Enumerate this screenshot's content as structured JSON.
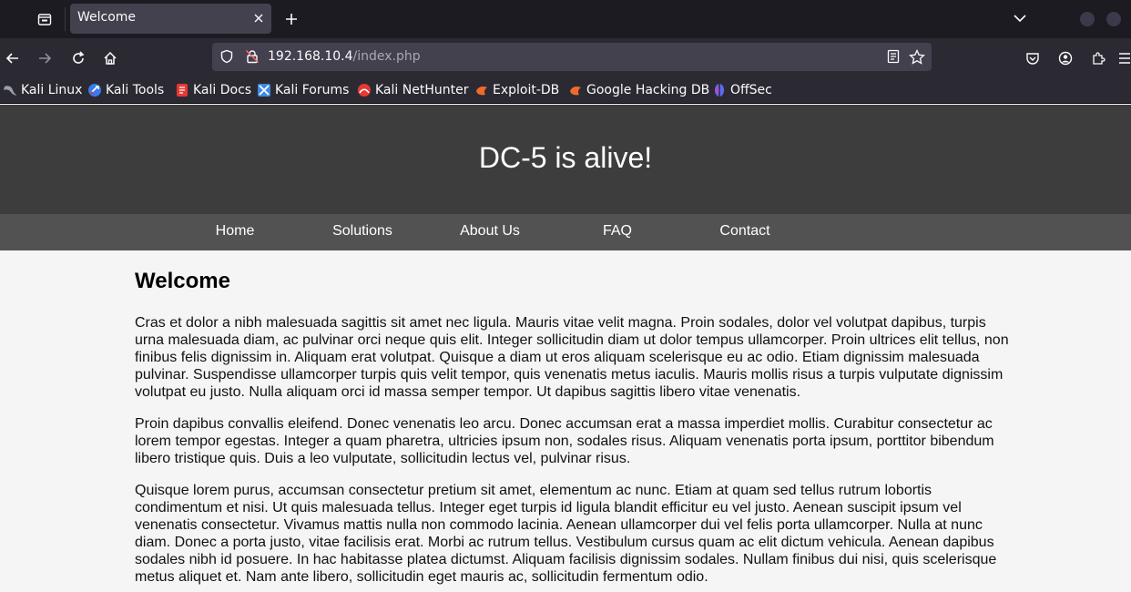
{
  "browser": {
    "tab_title": "Welcome",
    "url_host": "192.168.10.4",
    "url_path": "/index.php",
    "bookmarks": [
      {
        "label": "Kali Linux",
        "icon": "kali-dragon-icon",
        "color": "#9aa0a6"
      },
      {
        "label": "Kali Tools",
        "icon": "kali-tools-icon",
        "color": "#367bf0"
      },
      {
        "label": "Kali Docs",
        "icon": "kali-docs-icon",
        "color": "#e53935"
      },
      {
        "label": "Kali Forums",
        "icon": "kali-forums-icon",
        "color": "#3f8ae0"
      },
      {
        "label": "Kali NetHunter",
        "icon": "kali-nethunter-icon",
        "color": "#e53935"
      },
      {
        "label": "Exploit-DB",
        "icon": "exploit-db-icon",
        "color": "#f06a2b"
      },
      {
        "label": "Google Hacking DB",
        "icon": "ghdb-icon",
        "color": "#f06a2b"
      },
      {
        "label": "OffSec",
        "icon": "offsec-icon",
        "color": "#5b6cf0"
      }
    ]
  },
  "site": {
    "title": "DC-5 is alive!",
    "nav": [
      "Home",
      "Solutions",
      "About Us",
      "FAQ",
      "Contact"
    ],
    "heading": "Welcome",
    "paragraphs": [
      "Cras et dolor a nibh malesuada sagittis sit amet nec ligula. Mauris vitae velit magna. Proin sodales, dolor vel volutpat dapibus, turpis urna malesuada diam, ac pulvinar orci neque quis elit. Integer sollicitudin diam ut dolor tempus ullamcorper. Proin ultrices elit tellus, non finibus felis dignissim in. Aliquam erat volutpat. Quisque a diam ut eros aliquam scelerisque eu ac odio. Etiam dignissim malesuada pulvinar. Suspendisse ullamcorper turpis quis velit tempor, quis venenatis metus iaculis. Mauris mollis risus a turpis vulputate dignissim volutpat eu justo. Nulla aliquam orci id massa semper tempor. Ut dapibus sagittis libero vitae venenatis.",
      "Proin dapibus convallis eleifend. Donec venenatis leo arcu. Donec accumsan erat a massa imperdiet mollis. Curabitur consectetur ac lorem tempor egestas. Integer a quam pharetra, ultricies ipsum non, sodales risus. Aliquam venenatis porta ipsum, porttitor bibendum libero tristique quis. Duis a leo vulputate, sollicitudin lectus vel, pulvinar risus.",
      "Quisque lorem purus, accumsan consectetur pretium sit amet, elementum ac nunc. Etiam at quam sed tellus rutrum lobortis condimentum et nisi. Ut quis malesuada tellus. Integer eget turpis id ligula blandit efficitur eu vel justo. Aenean suscipit ipsum vel venenatis consectetur. Vivamus mattis nulla non commodo lacinia. Aenean ullamcorper dui vel felis porta ullamcorper. Nulla at nunc diam. Donec a porta justo, vitae facilisis erat. Morbi ac rutrum tellus. Vestibulum cursus quam ac elit dictum vehicula. Aenean dapibus sodales nibh id posuere. In hac habitasse platea dictumst. Aliquam facilisis dignissim sodales. Nullam finibus dui nisi, quis scelerisque metus aliquet et. Nam ante libero, sollicitudin eget mauris ac, sollicitudin fermentum odio."
    ]
  }
}
